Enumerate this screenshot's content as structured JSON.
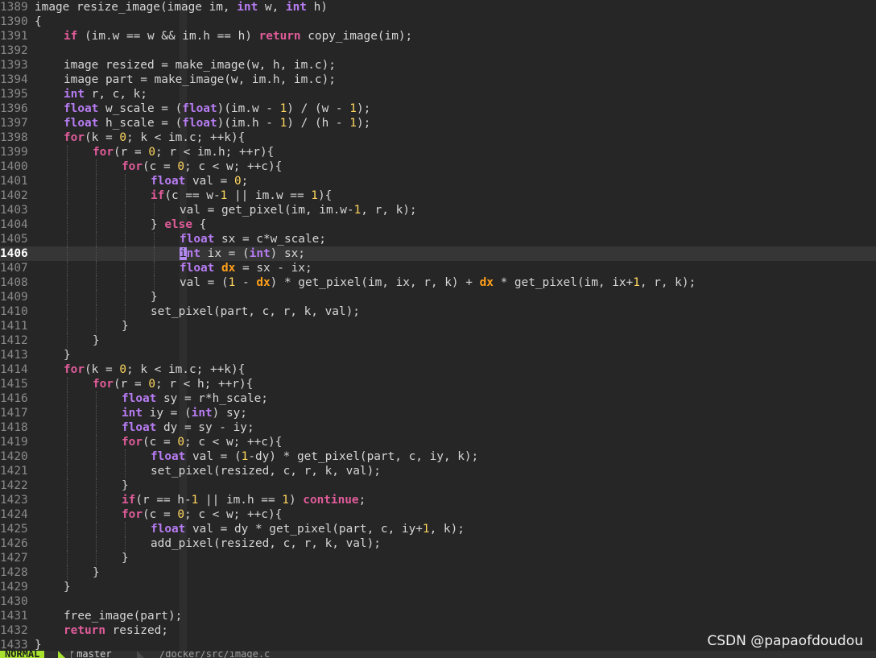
{
  "editor": {
    "cursor_line": 1406,
    "lines": [
      {
        "n": "1389",
        "i": 0,
        "t": [
          [
            "",
            "image resize_image(image im, "
          ],
          [
            "ty",
            "int"
          ],
          [
            "",
            " w, "
          ],
          [
            "ty",
            "int"
          ],
          [
            "",
            " h)"
          ]
        ]
      },
      {
        "n": "1390",
        "i": 0,
        "t": [
          [
            "",
            "{"
          ]
        ]
      },
      {
        "n": "1391",
        "i": 1,
        "t": [
          [
            "kw",
            "if"
          ],
          [
            "",
            " (im.w == w && im.h == h) "
          ],
          [
            "kw",
            "return"
          ],
          [
            "",
            " copy_image(im);"
          ]
        ]
      },
      {
        "n": "1392",
        "i": 0,
        "t": []
      },
      {
        "n": "1393",
        "i": 1,
        "t": [
          [
            "",
            "image resized = make_image(w, h, im.c);"
          ]
        ]
      },
      {
        "n": "1394",
        "i": 1,
        "t": [
          [
            "",
            "image part = make_image(w, im.h, im.c);"
          ]
        ]
      },
      {
        "n": "1395",
        "i": 1,
        "t": [
          [
            "ty",
            "int"
          ],
          [
            "",
            " r, c, k;"
          ]
        ]
      },
      {
        "n": "1396",
        "i": 1,
        "t": [
          [
            "ty",
            "float"
          ],
          [
            "",
            " w_scale = ("
          ],
          [
            "ty",
            "float"
          ],
          [
            "",
            ")(im.w - "
          ],
          [
            "num",
            "1"
          ],
          [
            "",
            ") / (w - "
          ],
          [
            "num",
            "1"
          ],
          [
            "",
            ");"
          ]
        ]
      },
      {
        "n": "1397",
        "i": 1,
        "t": [
          [
            "ty",
            "float"
          ],
          [
            "",
            " h_scale = ("
          ],
          [
            "ty",
            "float"
          ],
          [
            "",
            ")(im.h - "
          ],
          [
            "num",
            "1"
          ],
          [
            "",
            ") / (h - "
          ],
          [
            "num",
            "1"
          ],
          [
            "",
            ");"
          ]
        ]
      },
      {
        "n": "1398",
        "i": 1,
        "t": [
          [
            "kw",
            "for"
          ],
          [
            "",
            "(k = "
          ],
          [
            "num",
            "0"
          ],
          [
            "",
            "; k < im.c; ++k){"
          ]
        ]
      },
      {
        "n": "1399",
        "i": 2,
        "t": [
          [
            "kw",
            "for"
          ],
          [
            "",
            "(r = "
          ],
          [
            "num",
            "0"
          ],
          [
            "",
            "; r < im.h; ++r){"
          ]
        ]
      },
      {
        "n": "1400",
        "i": 3,
        "t": [
          [
            "kw",
            "for"
          ],
          [
            "",
            "(c = "
          ],
          [
            "num",
            "0"
          ],
          [
            "",
            "; c < w; ++c){"
          ]
        ]
      },
      {
        "n": "1401",
        "i": 4,
        "t": [
          [
            "ty",
            "float"
          ],
          [
            "",
            " val = "
          ],
          [
            "num",
            "0"
          ],
          [
            "",
            ";"
          ]
        ]
      },
      {
        "n": "1402",
        "i": 4,
        "t": [
          [
            "kw",
            "if"
          ],
          [
            "",
            "(c == w-"
          ],
          [
            "num",
            "1"
          ],
          [
            "",
            " || im.w == "
          ],
          [
            "num",
            "1"
          ],
          [
            "",
            "){"
          ]
        ]
      },
      {
        "n": "1403",
        "i": 5,
        "t": [
          [
            "",
            "val = get_pixel(im, im.w-"
          ],
          [
            "num",
            "1"
          ],
          [
            "",
            ", r, k);"
          ]
        ]
      },
      {
        "n": "1404",
        "i": 4,
        "t": [
          [
            "",
            "} "
          ],
          [
            "kw",
            "else"
          ],
          [
            "",
            " {"
          ]
        ]
      },
      {
        "n": "1405",
        "i": 5,
        "t": [
          [
            "ty",
            "float"
          ],
          [
            "",
            " sx = c*w_scale;"
          ]
        ]
      },
      {
        "n": "1406",
        "i": 5,
        "t": [
          [
            "cur",
            "i"
          ],
          [
            "ty",
            "nt"
          ],
          [
            "",
            " ix = ("
          ],
          [
            "ty",
            "int"
          ],
          [
            "",
            ") sx;"
          ]
        ]
      },
      {
        "n": "1407",
        "i": 5,
        "t": [
          [
            "ty",
            "float"
          ],
          [
            "",
            " "
          ],
          [
            "hl",
            "dx"
          ],
          [
            "",
            " = sx - ix;"
          ]
        ]
      },
      {
        "n": "1408",
        "i": 5,
        "t": [
          [
            "",
            "val = ("
          ],
          [
            "num",
            "1"
          ],
          [
            "",
            " - "
          ],
          [
            "hl",
            "dx"
          ],
          [
            "",
            ") * get_pixel(im, ix, r, k) + "
          ],
          [
            "hl",
            "dx"
          ],
          [
            "",
            " * get_pixel(im, ix+"
          ],
          [
            "num",
            "1"
          ],
          [
            "",
            ", r, k);"
          ]
        ]
      },
      {
        "n": "1409",
        "i": 4,
        "t": [
          [
            "",
            "}"
          ]
        ]
      },
      {
        "n": "1410",
        "i": 4,
        "t": [
          [
            "",
            "set_pixel(part, c, r, k, val);"
          ]
        ]
      },
      {
        "n": "1411",
        "i": 3,
        "t": [
          [
            "",
            "}"
          ]
        ]
      },
      {
        "n": "1412",
        "i": 2,
        "t": [
          [
            "",
            "}"
          ]
        ]
      },
      {
        "n": "1413",
        "i": 1,
        "t": [
          [
            "",
            "}"
          ]
        ]
      },
      {
        "n": "1414",
        "i": 1,
        "t": [
          [
            "kw",
            "for"
          ],
          [
            "",
            "(k = "
          ],
          [
            "num",
            "0"
          ],
          [
            "",
            "; k < im.c; ++k){"
          ]
        ]
      },
      {
        "n": "1415",
        "i": 2,
        "t": [
          [
            "kw",
            "for"
          ],
          [
            "",
            "(r = "
          ],
          [
            "num",
            "0"
          ],
          [
            "",
            "; r < h; ++r){"
          ]
        ]
      },
      {
        "n": "1416",
        "i": 3,
        "t": [
          [
            "ty",
            "float"
          ],
          [
            "",
            " sy = r*h_scale;"
          ]
        ]
      },
      {
        "n": "1417",
        "i": 3,
        "t": [
          [
            "ty",
            "int"
          ],
          [
            "",
            " iy = ("
          ],
          [
            "ty",
            "int"
          ],
          [
            "",
            ") sy;"
          ]
        ]
      },
      {
        "n": "1418",
        "i": 3,
        "t": [
          [
            "ty",
            "float"
          ],
          [
            "",
            " dy = sy - iy;"
          ]
        ]
      },
      {
        "n": "1419",
        "i": 3,
        "t": [
          [
            "kw",
            "for"
          ],
          [
            "",
            "(c = "
          ],
          [
            "num",
            "0"
          ],
          [
            "",
            "; c < w; ++c){"
          ]
        ]
      },
      {
        "n": "1420",
        "i": 4,
        "t": [
          [
            "ty",
            "float"
          ],
          [
            "",
            " val = ("
          ],
          [
            "num",
            "1"
          ],
          [
            "",
            "-dy) * get_pixel(part, c, iy, k);"
          ]
        ]
      },
      {
        "n": "1421",
        "i": 4,
        "t": [
          [
            "",
            "set_pixel(resized, c, r, k, val);"
          ]
        ]
      },
      {
        "n": "1422",
        "i": 3,
        "t": [
          [
            "",
            "}"
          ]
        ]
      },
      {
        "n": "1423",
        "i": 3,
        "t": [
          [
            "kw",
            "if"
          ],
          [
            "",
            "(r == h-"
          ],
          [
            "num",
            "1"
          ],
          [
            "",
            " || im.h == "
          ],
          [
            "num",
            "1"
          ],
          [
            "",
            ") "
          ],
          [
            "kw",
            "continue"
          ],
          [
            "",
            ";"
          ]
        ]
      },
      {
        "n": "1424",
        "i": 3,
        "t": [
          [
            "kw",
            "for"
          ],
          [
            "",
            "(c = "
          ],
          [
            "num",
            "0"
          ],
          [
            "",
            "; c < w; ++c){"
          ]
        ]
      },
      {
        "n": "1425",
        "i": 4,
        "t": [
          [
            "ty",
            "float"
          ],
          [
            "",
            " val = dy * get_pixel(part, c, iy+"
          ],
          [
            "num",
            "1"
          ],
          [
            "",
            ", k);"
          ]
        ]
      },
      {
        "n": "1426",
        "i": 4,
        "t": [
          [
            "",
            "add_pixel(resized, c, r, k, val);"
          ]
        ]
      },
      {
        "n": "1427",
        "i": 3,
        "t": [
          [
            "",
            "}"
          ]
        ]
      },
      {
        "n": "1428",
        "i": 2,
        "t": [
          [
            "",
            "}"
          ]
        ]
      },
      {
        "n": "1429",
        "i": 1,
        "t": [
          [
            "",
            "}"
          ]
        ]
      },
      {
        "n": "1430",
        "i": 0,
        "t": []
      },
      {
        "n": "1431",
        "i": 1,
        "t": [
          [
            "",
            "free_image(part);"
          ]
        ]
      },
      {
        "n": "1432",
        "i": 1,
        "t": [
          [
            "kw",
            "return"
          ],
          [
            "",
            " resized;"
          ]
        ]
      },
      {
        "n": "1433",
        "i": 0,
        "t": [
          [
            "",
            "}"
          ]
        ]
      }
    ]
  },
  "statusbar": {
    "mode": "NORMAL",
    "branch_icon": "git-branch-icon",
    "branch": "master",
    "filepath": "/docker/src/image.c"
  },
  "watermark": "CSDN @papaofdoudou",
  "colors": {
    "background": "#262626",
    "keyword": "#e05c9a",
    "type": "#b77cf2",
    "number": "#ffd75f",
    "highlight": "#ff9f1a",
    "mode_badge": "#a6e22e"
  }
}
